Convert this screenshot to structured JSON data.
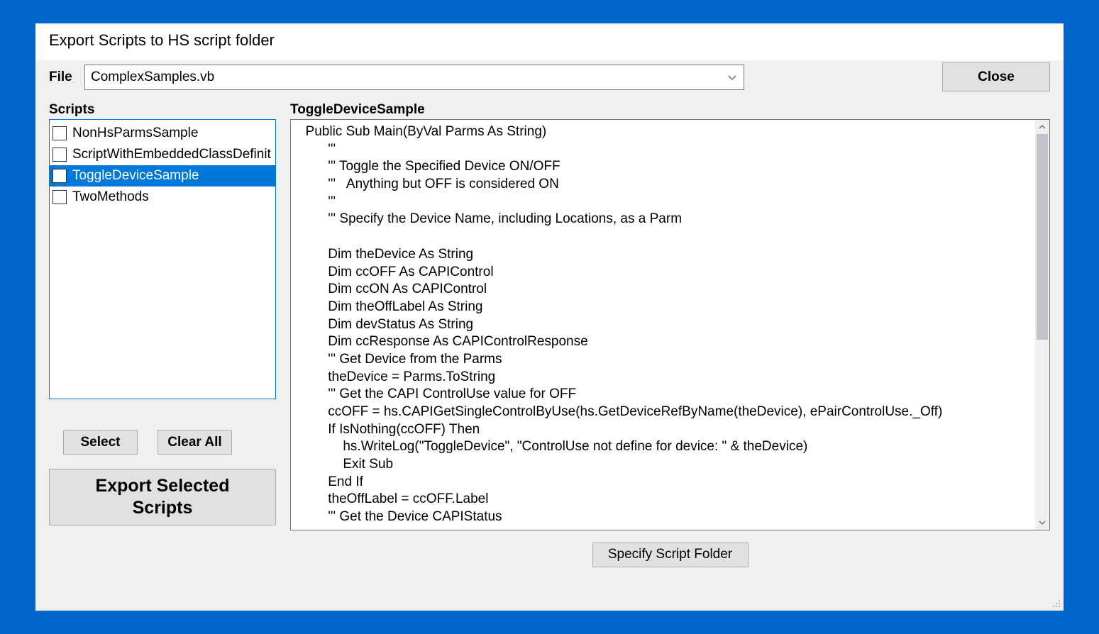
{
  "window": {
    "title": "Export Scripts to HS script folder"
  },
  "file": {
    "label": "File",
    "value": "ComplexSamples.vb"
  },
  "buttons": {
    "close": "Close",
    "select": "Select",
    "clearAll": "Clear All",
    "export": "Export Selected\nScripts",
    "specifyFolder": "Specify Script Folder"
  },
  "scripts": {
    "label": "Scripts",
    "items": [
      {
        "name": "NonHsParmsSample",
        "checked": false,
        "selected": false
      },
      {
        "name": "ScriptWithEmbeddedClassDefinit",
        "checked": false,
        "selected": false
      },
      {
        "name": "ToggleDeviceSample",
        "checked": false,
        "selected": true
      },
      {
        "name": "TwoMethods",
        "checked": false,
        "selected": false
      }
    ]
  },
  "preview": {
    "label": "ToggleDeviceSample",
    "code": "  Public Sub Main(ByVal Parms As String)\n        '''\n        ''' Toggle the Specified Device ON/OFF\n        '''   Anything but OFF is considered ON\n        '''\n        ''' Specify the Device Name, including Locations, as a Parm\n\n        Dim theDevice As String\n        Dim ccOFF As CAPIControl\n        Dim ccON As CAPIControl\n        Dim theOffLabel As String\n        Dim devStatus As String\n        Dim ccResponse As CAPIControlResponse\n        ''' Get Device from the Parms\n        theDevice = Parms.ToString\n        ''' Get the CAPI ControlUse value for OFF\n        ccOFF = hs.CAPIGetSingleControlByUse(hs.GetDeviceRefByName(theDevice), ePairControlUse._Off)\n        If IsNothing(ccOFF) Then\n            hs.WriteLog(\"ToggleDevice\", \"ControlUse not define for device: \" & theDevice)\n            Exit Sub\n        End If\n        theOffLabel = ccOFF.Label\n        ''' Get the Device CAPIStatus"
  }
}
